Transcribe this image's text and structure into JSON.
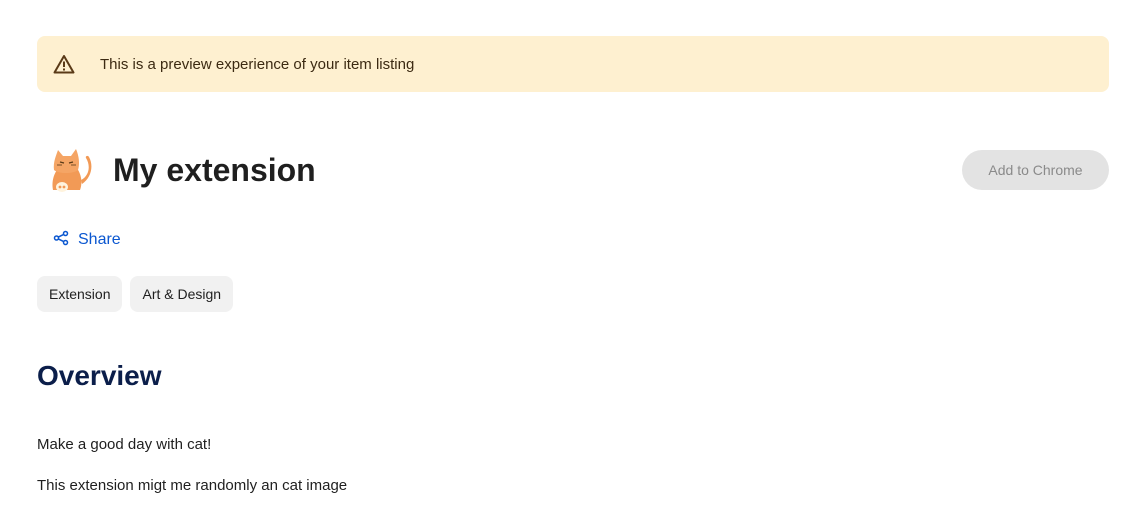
{
  "banner": {
    "icon": "warning-icon",
    "text": "This is a preview experience of your item listing",
    "background": "#fef0d0"
  },
  "header": {
    "icon": "cat-extension-icon",
    "title": "My extension",
    "add_button_label": "Add to Chrome"
  },
  "share": {
    "icon": "share-icon",
    "label": "Share",
    "color": "#0b57d0"
  },
  "chips": [
    {
      "label": "Extension"
    },
    {
      "label": "Art & Design"
    }
  ],
  "overview": {
    "title": "Overview",
    "title_color": "#0b1e4a",
    "paragraphs": [
      "Make a good day with cat!",
      "This extension migt me randomly an cat image"
    ]
  }
}
